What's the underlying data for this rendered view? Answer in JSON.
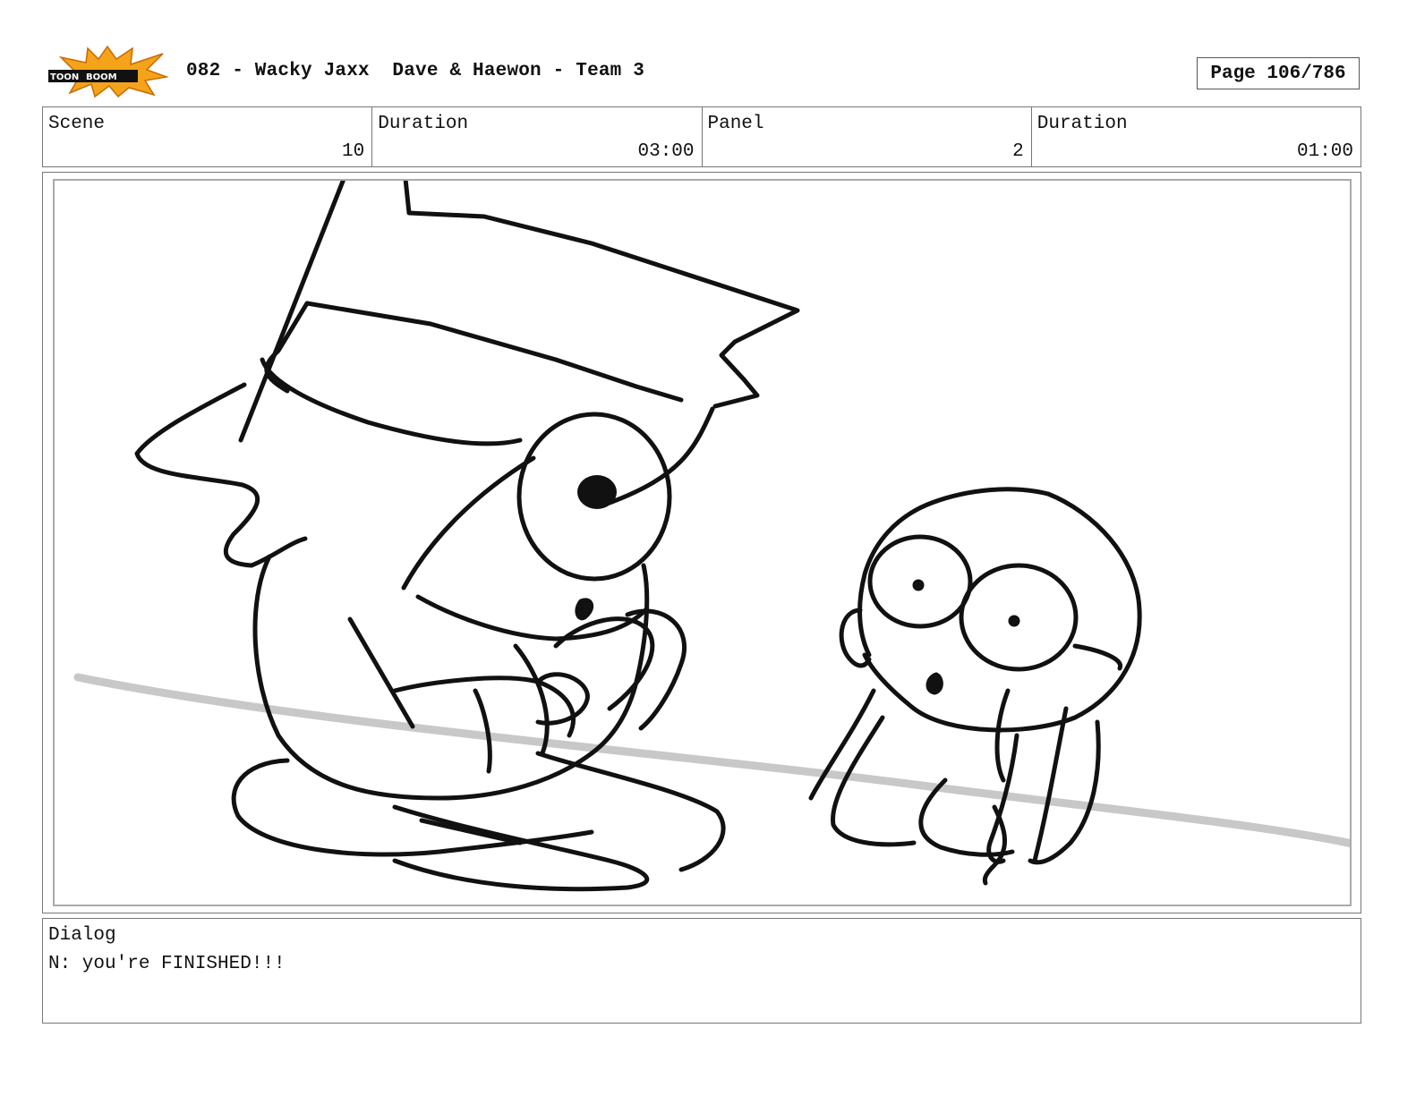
{
  "header": {
    "logo_text": "TOON BOOM",
    "title": "082 - Wacky Jaxx  Dave & Haewon - Team 3",
    "page": "Page 106/786"
  },
  "info": {
    "scene_label": "Scene",
    "scene_value": "10",
    "scene_duration_label": "Duration",
    "scene_duration_value": "03:00",
    "panel_label": "Panel",
    "panel_value": "2",
    "panel_duration_label": "Duration",
    "panel_duration_value": "01:00"
  },
  "dialog": {
    "label": "Dialog",
    "text": "N: you're FINISHED!!!"
  },
  "colors": {
    "logo_burst": "#f5a31a",
    "logo_band": "#111111",
    "sketch_line": "#111111",
    "ground_line": "#c8c8c8"
  }
}
